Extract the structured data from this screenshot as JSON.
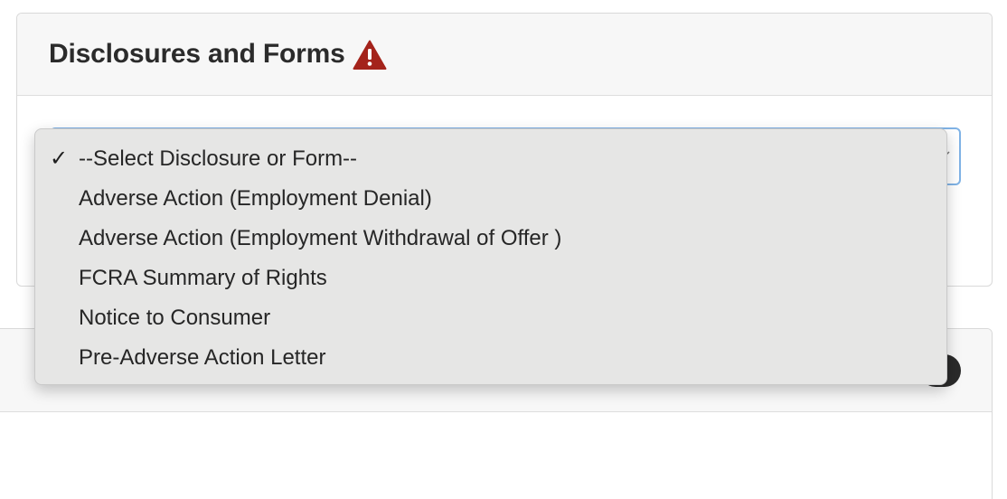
{
  "card": {
    "title": "Disclosures and Forms",
    "warning_color": "#a4231b"
  },
  "select": {
    "selected_value": "--Select Disclosure or Form--"
  },
  "dropdown": {
    "check_glyph": "✓",
    "options": [
      {
        "label": "--Select Disclosure or Form--",
        "selected": true
      },
      {
        "label": "Adverse Action (Employment Denial)",
        "selected": false
      },
      {
        "label": "Adverse Action (Employment Withdrawal of Offer )",
        "selected": false
      },
      {
        "label": "FCRA Summary of Rights",
        "selected": false
      },
      {
        "label": "Notice to Consumer",
        "selected": false
      },
      {
        "label": "Pre-Adverse Action Letter",
        "selected": false
      }
    ]
  },
  "icons": {
    "warning": "warning-triangle-icon",
    "check": "checkmark-icon",
    "chevron": "chevron-down-icon"
  }
}
